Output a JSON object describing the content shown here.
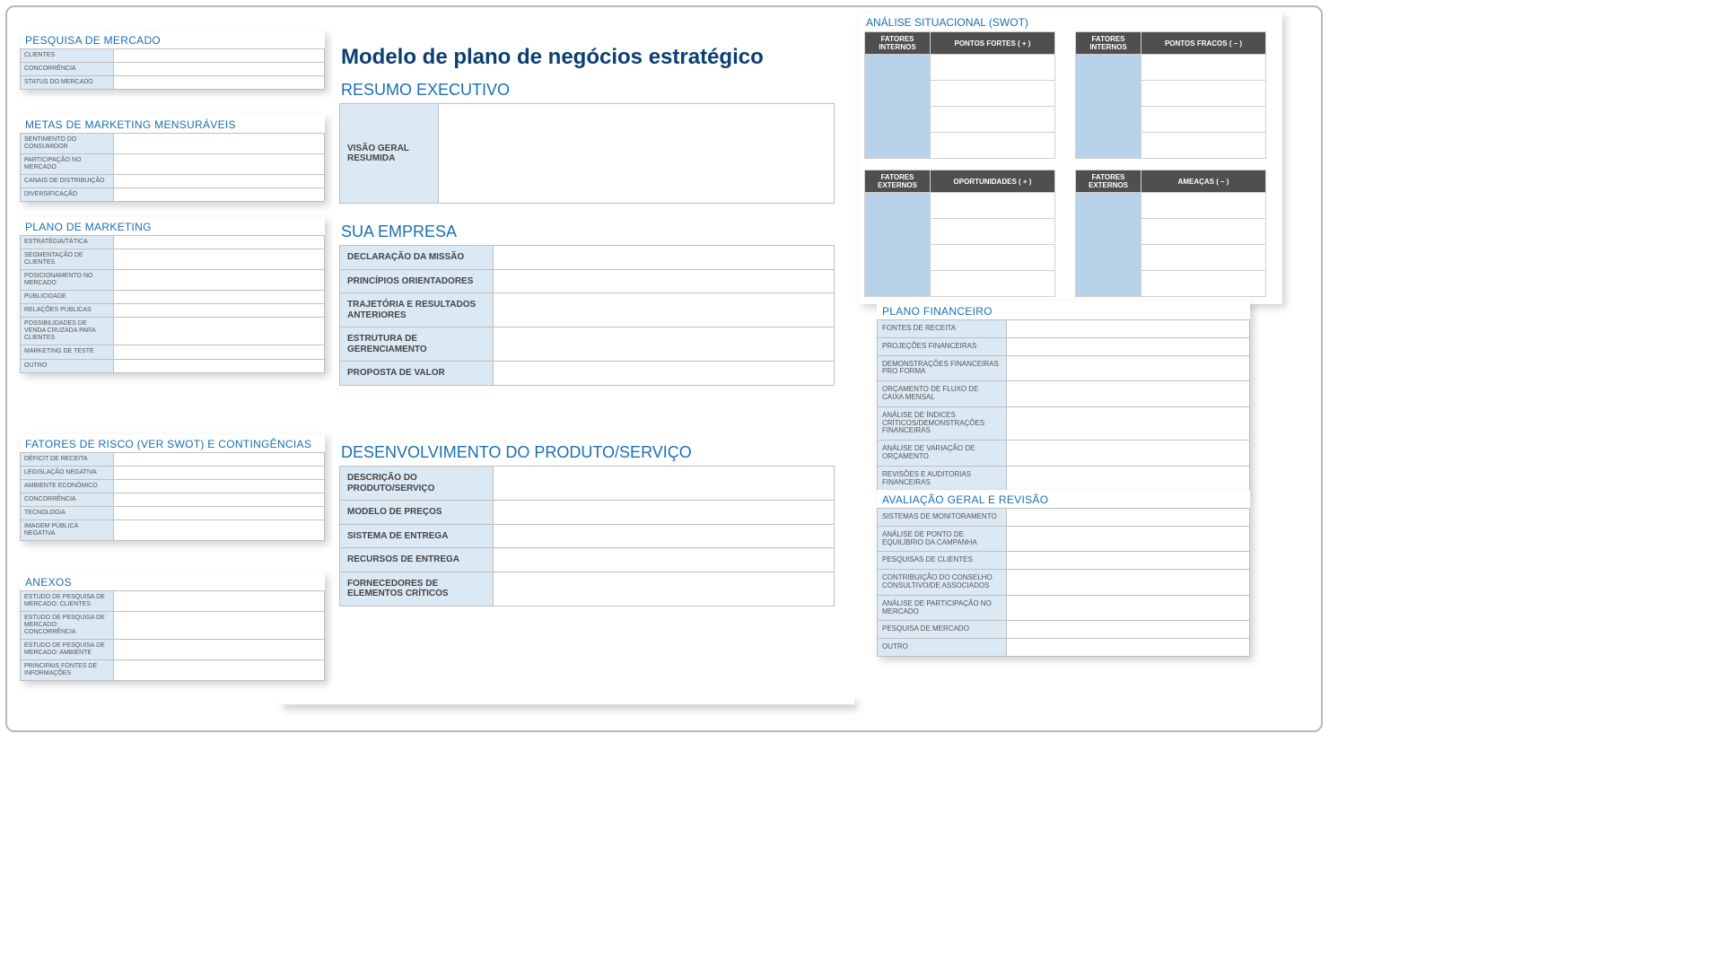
{
  "main_title": "Modelo de plano de negócios estratégico",
  "left": {
    "pesquisa_mercado": {
      "title": "PESQUISA DE MERCADO",
      "rows": [
        "CLIENTES",
        "CONCORRÊNCIA",
        "STATUS DO MERCADO"
      ]
    },
    "metas_marketing": {
      "title": "METAS DE MARKETING MENSURÁVEIS",
      "rows": [
        "SENTIMENTO DO CONSUMIDOR",
        "PARTICIPAÇÃO NO MERCADO",
        "CANAIS DE DISTRIBUIÇÃO",
        "DIVERSIFICAÇÃO"
      ]
    },
    "plano_marketing": {
      "title": "PLANO DE MARKETING",
      "rows": [
        "ESTRATÉGIA/TÁTICA",
        "SEGMENTAÇÃO DE CLIENTES",
        "POSICIONAMENTO NO MERCADO",
        "PUBLICIDADE",
        "RELAÇÕES PÚBLICAS",
        "POSSIBILIDADES DE VENDA CRUZADA PARA CLIENTES",
        "MARKETING DE TESTE",
        "OUTRO"
      ]
    },
    "fatores_risco": {
      "title": "FATORES DE RISCO (VER SWOT) E CONTINGÊNCIAS",
      "rows": [
        "DÉFICIT DE RECEITA",
        "LEGISLAÇÃO NEGATIVA",
        "AMBIENTE ECONÔMICO",
        "CONCORRÊNCIA",
        "TECNOLOGIA",
        "IMAGEM PÚBLICA NEGATIVA"
      ]
    },
    "anexos": {
      "title": "ANEXOS",
      "rows": [
        "ESTUDO DE PESQUISA DE MERCADO: CLIENTES",
        "ESTUDO DE PESQUISA DE MERCADO: CONCORRÊNCIA",
        "ESTUDO DE PESQUISA DE MERCADO: AMBIENTE",
        "PRINCIPAIS FONTES DE INFORMAÇÕES"
      ]
    }
  },
  "center": {
    "resumo": {
      "title": "RESUMO EXECUTIVO",
      "label": "VISÃO GERAL RESUMIDA"
    },
    "empresa": {
      "title": "SUA EMPRESA",
      "rows": [
        "DECLARAÇÃO DA MISSÃO",
        "PRINCÍPIOS ORIENTADORES",
        "TRAJETÓRIA E RESULTADOS ANTERIORES",
        "ESTRUTURA DE GERENCIAMENTO",
        "PROPOSTA DE VALOR"
      ]
    },
    "desenvolvimento": {
      "title": "DESENVOLVIMENTO DO PRODUTO/SERVIÇO",
      "rows": [
        "DESCRIÇÃO DO PRODUTO/SERVIÇO",
        "MODELO DE PREÇOS",
        "SISTEMA DE ENTREGA",
        "RECURSOS DE ENTREGA",
        "FORNECEDORES DE ELEMENTOS CRÍTICOS"
      ]
    }
  },
  "swot": {
    "title": "ANÁLISE SITUACIONAL (SWOT)",
    "q1": {
      "side": "FATORES INTERNOS",
      "head": "PONTOS FORTES ( + )"
    },
    "q2": {
      "side": "FATORES INTERNOS",
      "head": "PONTOS FRACOS ( – )"
    },
    "q3": {
      "side": "FATORES EXTERNOS",
      "head": "OPORTUNIDADES ( + )"
    },
    "q4": {
      "side": "FATORES EXTERNOS",
      "head": "AMEAÇAS ( – )"
    }
  },
  "right": {
    "financeiro": {
      "title": "PLANO FINANCEIRO",
      "rows": [
        "FONTES DE RECEITA",
        "PROJEÇÕES FINANCEIRAS",
        "DEMONSTRAÇÕES FINANCEIRAS PRO FORMA",
        "ORÇAMENTO DE FLUXO DE CAIXA MENSAL",
        "ANÁLISE DE ÍNDICES CRÍTICOS/DEMONSTRAÇÕES FINANCEIRAS",
        "ANÁLISE DE VARIAÇÃO DE ORÇAMENTO",
        "REVISÕES E AUDITORIAS FINANCEIRAS"
      ]
    },
    "avaliacao": {
      "title": "AVALIAÇÃO GERAL E REVISÃO",
      "rows": [
        "SISTEMAS DE MONITORAMENTO",
        "ANÁLISE DE PONTO DE EQUILÍBRIO DA CAMPANHA",
        "PESQUISAS DE CLIENTES",
        "CONTRIBUIÇÃO DO CONSELHO CONSULTIVO/DE ASSOCIADOS",
        "ANÁLISE DE PARTICIPAÇÃO NO MERCADO",
        "PESQUISA DE MERCADO",
        "OUTRO"
      ]
    }
  }
}
